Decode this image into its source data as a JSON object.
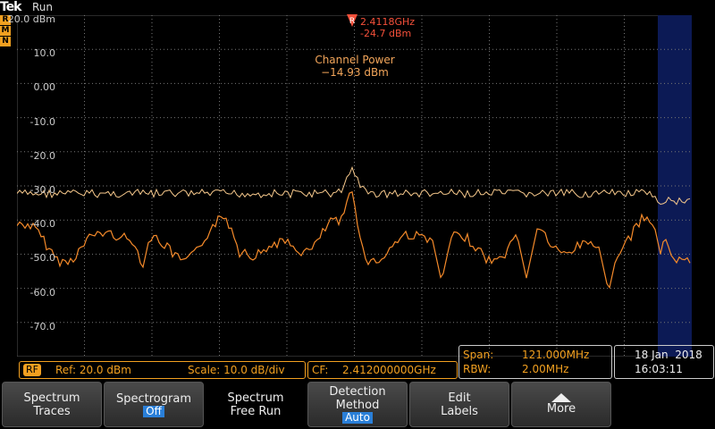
{
  "header": {
    "logo": "Tek",
    "status": "Run",
    "trace_badges": [
      "R",
      "M",
      "N"
    ]
  },
  "y_axis": {
    "labels": [
      "20.0 dBm",
      "10.0",
      "0.00",
      "-10.0",
      "-20.0",
      "-30.0",
      "-40.0",
      "-50.0",
      "-60.0",
      "-70.0"
    ]
  },
  "marker": {
    "badge": "R",
    "freq": "2.4118GHz",
    "level": "-24.7 dBm"
  },
  "measurement": {
    "title": "Channel Power",
    "value": "−14.93 dBm"
  },
  "rf_box": {
    "badge": "RF",
    "ref": "Ref: 20.0 dBm",
    "scale": "Scale: 10.0 dB/div"
  },
  "cf_box": {
    "label": "CF:",
    "value": "2.412000000GHz"
  },
  "span_box": {
    "span_label": "Span:",
    "span_value": "121.000MHz",
    "rbw_label": "RBW:",
    "rbw_value": "2.00MHz"
  },
  "datetime": {
    "date": "18 Jan  2018",
    "time": "16:03:11"
  },
  "softkeys": [
    {
      "line1": "Spectrum",
      "line2": "Traces",
      "value": ""
    },
    {
      "line1": "Spectrogram",
      "line2": "",
      "value": "Off"
    },
    {
      "line1": "Spectrum",
      "line2": "Free Run",
      "value": ""
    },
    {
      "line1": "Detection",
      "line2": "Method",
      "value": "Auto"
    },
    {
      "line1": "Edit",
      "line2": "Labels",
      "value": ""
    },
    {
      "line1": "More",
      "line2": "",
      "value": ""
    }
  ],
  "colors": {
    "trace_max": "#f7c98c",
    "trace_normal": "#f58a2a",
    "accent": "#f2a020",
    "marker": "#f5503a",
    "highlight": "#2a7fd8"
  }
}
